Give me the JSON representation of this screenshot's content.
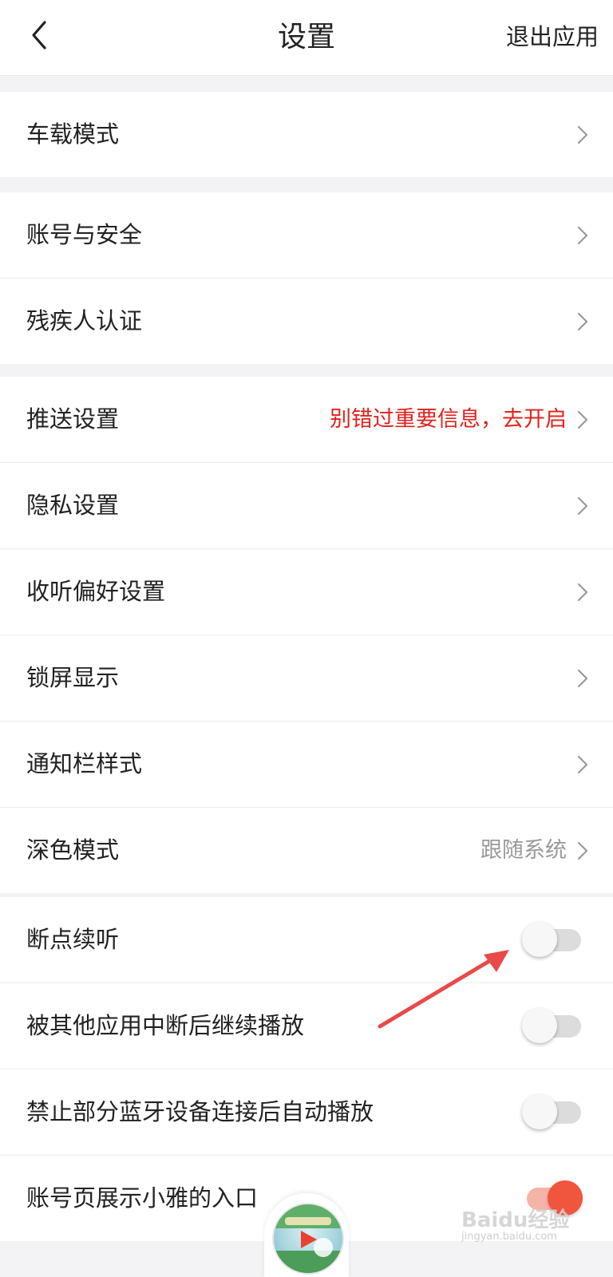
{
  "header": {
    "title": "设置",
    "exit_label": "退出应用"
  },
  "groups": [
    {
      "rows": [
        {
          "label": "车载模式"
        }
      ]
    },
    {
      "rows": [
        {
          "label": "账号与安全"
        },
        {
          "label": "残疾人认证"
        }
      ]
    },
    {
      "rows": [
        {
          "label": "推送设置",
          "value": "别错过重要信息，去开启"
        },
        {
          "label": "隐私设置"
        },
        {
          "label": "收听偏好设置"
        },
        {
          "label": "锁屏显示"
        },
        {
          "label": "通知栏样式"
        },
        {
          "label": "深色模式",
          "value": "跟随系统"
        }
      ]
    },
    {
      "rows": [
        {
          "label": "断点续听",
          "toggle_on": false
        },
        {
          "label": "被其他应用中断后继续播放",
          "toggle_on": false
        },
        {
          "label": "禁止部分蓝牙设备连接后自动播放",
          "toggle_on": false
        },
        {
          "label": "账号页展示小雅的入口",
          "toggle_on": true
        }
      ]
    }
  ],
  "colors": {
    "promo_text": "#e2211c",
    "toggle_on": "#f0553e",
    "annotation_arrow": "#e84a4a"
  },
  "watermark": {
    "brand": "Baidu经验",
    "url": "jingyan.baidu.com"
  },
  "icons": {
    "back": "chevron-left-icon",
    "row_chevron": "chevron-right-icon",
    "player": "play-icon"
  }
}
